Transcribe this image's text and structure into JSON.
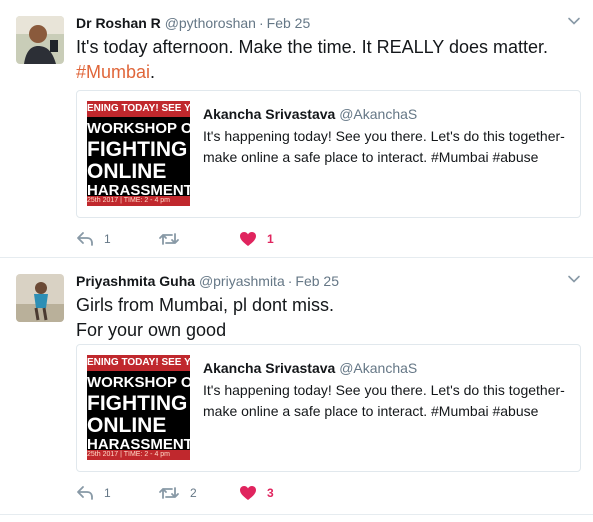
{
  "tweets": [
    {
      "name": "Dr Roshan R",
      "handle": "@pythoroshan",
      "separator": "·",
      "date": "Feb 25",
      "text_line1": "It's today afternoon. Make the time. It REALLY does matter.",
      "hashtag": "#Mumbai",
      "text_line2_suffix": ".",
      "quote": {
        "name": "Akancha Srivastava",
        "handle": "@AkanchaS",
        "text": "It's happening today! See you there. Let's do this together- make online a safe place to interact. #Mumbai #abuse",
        "image": {
          "band_top": "ENING TODAY! SEE Y",
          "line1": "WORKSHOP ON",
          "line2": "FIGHTING",
          "line3": "ONLINE",
          "line4": "HARASSMENT",
          "band_bottom": "25th 2017 | TIME: 2 - 4 pm"
        }
      },
      "reply_count": "1",
      "retweet_count": "",
      "like_count": "1"
    },
    {
      "name": "Priyashmita Guha",
      "handle": "@priyashmita",
      "separator": "·",
      "date": "Feb 25",
      "text_line1": "Girls from Mumbai, pl dont miss.",
      "text_line2": "For your own good",
      "quote": {
        "name": "Akancha Srivastava",
        "handle": "@AkanchaS",
        "text": "It's happening today! See you there. Let's do this together- make online a safe place to interact. #Mumbai #abuse",
        "image": {
          "band_top": "ENING TODAY! SEE Y",
          "line1": "WORKSHOP ON",
          "line2": "FIGHTING",
          "line3": "ONLINE",
          "line4": "HARASSMENT",
          "band_bottom": "25th 2017 | TIME: 2 - 4 pm"
        }
      },
      "reply_count": "1",
      "retweet_count": "2",
      "like_count": "3"
    }
  ],
  "colors": {
    "hashtag": "#e0663a",
    "like": "#e0245e",
    "muted": "#657786",
    "border": "#e1e8ed",
    "poster_red": "#c0282d"
  },
  "icons": [
    "reply-icon",
    "retweet-icon",
    "heart-icon",
    "caret-down-icon"
  ]
}
